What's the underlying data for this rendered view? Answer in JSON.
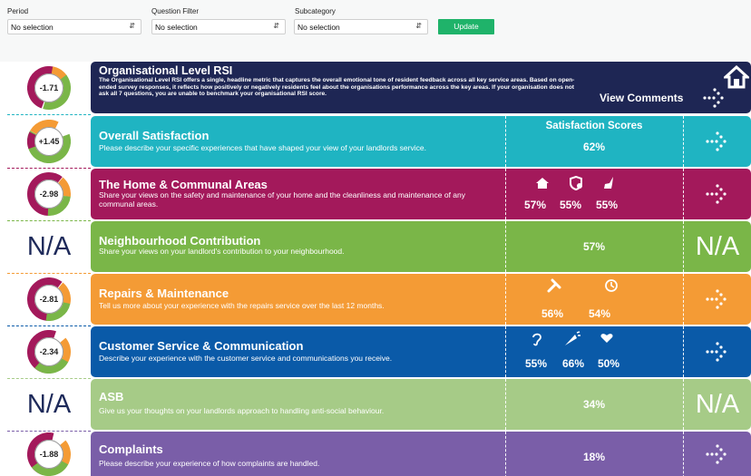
{
  "filters": {
    "period": {
      "label": "Period",
      "value": "No selection"
    },
    "question": {
      "label": "Question Filter",
      "value": "No selection"
    },
    "subcategory": {
      "label": "Subcategory",
      "value": "No selection"
    },
    "update_label": "Update"
  },
  "colors": {
    "navy": "#1e2654",
    "teal": "#1fb4c2",
    "magenta": "#a3195b",
    "green": "#7ab648",
    "orange": "#f49b35",
    "blue": "#0a5aa8",
    "lightgreen": "#a6cb87",
    "purple": "#7a5ea8",
    "donut_green": "#7ab648",
    "donut_magenta": "#a3195b",
    "donut_orange": "#f49b35"
  },
  "org": {
    "score": "-1.71",
    "title": "Organisational Level RSI",
    "desc": "The Organisational Level RSI offers a single, headline metric that captures the overall emotional tone of resident feedback across all key service areas. Based on open-ended survey responses, it reflects how positively or negatively residents feel about the organisations performance across the key areas. If your organisation does not ask all 7 questions, you are unable to benchmark your organisational RSI score.",
    "view_comments": "View Comments"
  },
  "rows": [
    {
      "score": "+1.45",
      "title": "Overall Satisfaction",
      "desc": "Please describe your specific experiences that have shaped your view of your landlords service.",
      "score_header": "Satisfaction Scores",
      "pcts": [
        "62%"
      ]
    },
    {
      "score": "-2.98",
      "title": "The Home & Communal Areas",
      "desc": "Share your views on the safety and maintenance of your home and the cleanliness and maintenance of any communal areas.",
      "pcts": [
        "57%",
        "55%",
        "55%"
      ],
      "icons": [
        "home-icon",
        "shield-icon",
        "sweep-icon"
      ]
    },
    {
      "score": "N/A",
      "title": "Neighbourhood Contribution",
      "desc": "Share your views on your landlord's contribution to your neighbourhood.",
      "pcts": [
        "57%"
      ],
      "right_na": "N/A"
    },
    {
      "score": "-2.81",
      "title": "Repairs & Maintenance",
      "desc": "Tell us more about your experience with the repairs service over the last 12 months.",
      "pcts": [
        "56%",
        "54%"
      ],
      "icons": [
        "tools-icon",
        "clock-icon"
      ]
    },
    {
      "score": "-2.34",
      "title": "Customer Service & Communication",
      "desc": "Describe your experience with the customer service and communications you receive.",
      "pcts": [
        "55%",
        "66%",
        "50%"
      ],
      "icons": [
        "ear-icon",
        "megaphone-icon",
        "heart-hands-icon"
      ]
    },
    {
      "score": "N/A",
      "title": "ASB",
      "desc": "Give us your thoughts on your landlords approach to handling anti-social behaviour.",
      "pcts": [
        "34%"
      ],
      "right_na": "N/A"
    },
    {
      "score": "-1.88",
      "title": "Complaints",
      "desc": "Please describe your experience of how complaints are handled.",
      "pcts": [
        "18%"
      ]
    }
  ]
}
